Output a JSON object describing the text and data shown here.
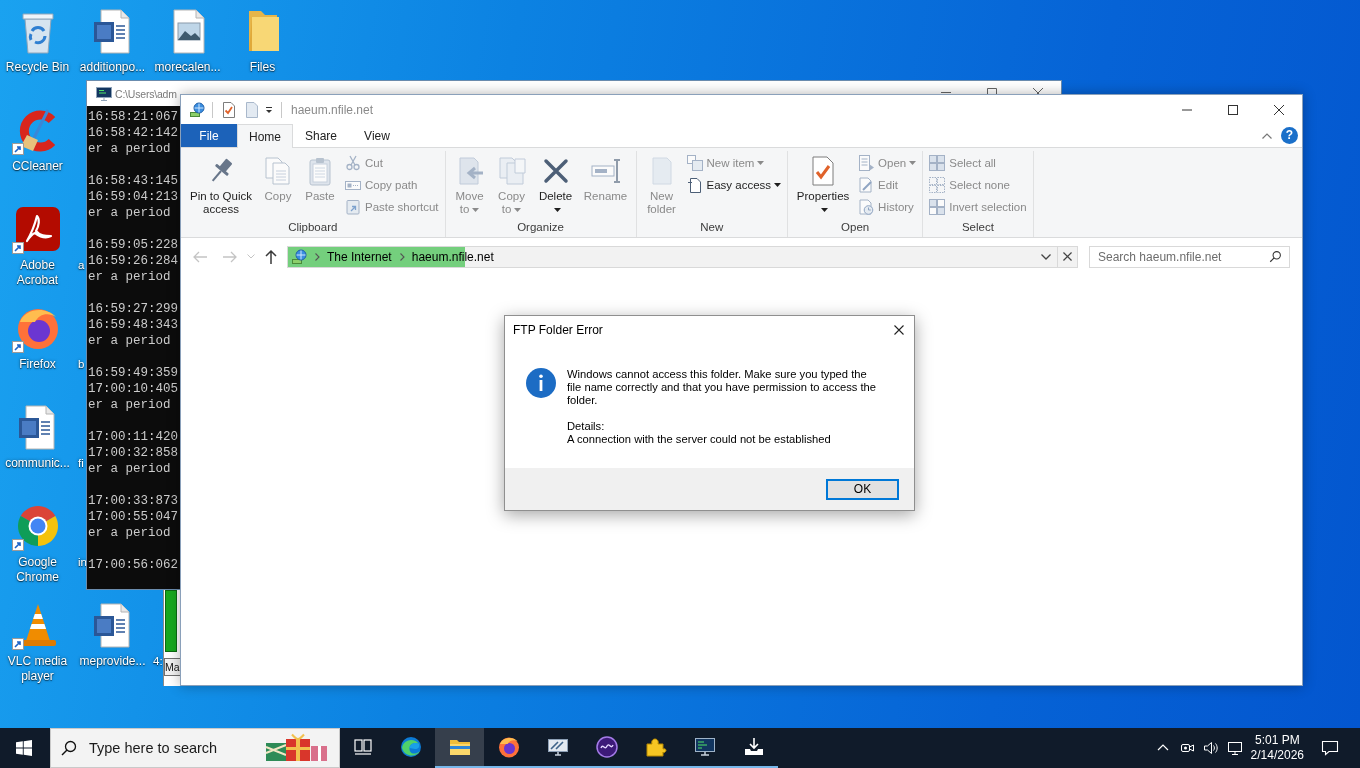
{
  "desktop": {
    "icons": [
      {
        "label": "Recycle Bin",
        "kind": "recycle-bin",
        "shortcut": false
      },
      {
        "label": "CCleaner",
        "kind": "ccleaner",
        "shortcut": true
      },
      {
        "label": "Adobe Acrobat",
        "kind": "acrobat",
        "shortcut": true
      },
      {
        "label": "Firefox",
        "kind": "firefox",
        "shortcut": true
      },
      {
        "label": "communic...",
        "kind": "word-document",
        "shortcut": false
      },
      {
        "label": "Google Chrome",
        "kind": "chrome",
        "shortcut": true
      },
      {
        "label": "VLC media player",
        "kind": "vlc",
        "shortcut": true
      },
      {
        "label": "additionpo...",
        "kind": "word-document",
        "shortcut": false
      },
      {
        "label": "a",
        "kind": "covered"
      },
      {
        "label": "b",
        "kind": "covered"
      },
      {
        "label": "fi",
        "kind": "covered"
      },
      {
        "label": "in",
        "kind": "covered"
      },
      {
        "label": "meprovide...",
        "kind": "word-document",
        "shortcut": false
      },
      {
        "label": "morecalen...",
        "kind": "image-file",
        "shortcut": false
      },
      {
        "label": "4:",
        "kind": "covered"
      },
      {
        "label": "Files",
        "kind": "folder",
        "shortcut": false
      }
    ]
  },
  "background_window": {
    "button": "Ma"
  },
  "console_window": {
    "title": "C:\\Users\\adm",
    "output": [
      [
        "16:58:21:067",
        "16:58:42:142",
        "er a period"
      ],
      [
        "16:58:43:145",
        "16:59:04:213",
        "er a period"
      ],
      [
        "16:59:05:228",
        "16:59:26:284",
        "er a period"
      ],
      [
        "16:59:27:299",
        "16:59:48:343",
        "er a period"
      ],
      [
        "16:59:49:359",
        "17:00:10:405",
        "er a period"
      ],
      [
        "17:00:11:420",
        "17:00:32:858",
        "er a period"
      ],
      [
        "17:00:33:873",
        "17:00:55:047",
        "er a period"
      ],
      [
        "17:00:56:062"
      ]
    ]
  },
  "explorer": {
    "title": "haeum.nfile.net",
    "tabs": [
      {
        "label": "File",
        "kind": "menu",
        "selected": false
      },
      {
        "label": "Home",
        "kind": "tab",
        "selected": true
      },
      {
        "label": "Share",
        "kind": "tab",
        "selected": false
      },
      {
        "label": "View",
        "kind": "tab",
        "selected": false
      }
    ],
    "help": "?",
    "ribbon": {
      "groups": [
        {
          "label": "Clipboard",
          "commands": [
            {
              "label": "Pin to Quick access",
              "kind": "large",
              "disabled": false,
              "dropdown": false
            },
            {
              "label": "Copy",
              "kind": "large",
              "disabled": true,
              "dropdown": false
            },
            {
              "label": "Paste",
              "kind": "large",
              "disabled": true,
              "dropdown": false
            },
            {
              "label": "Cut",
              "kind": "small",
              "disabled": true,
              "dropdown": false
            },
            {
              "label": "Copy path",
              "kind": "small",
              "disabled": true,
              "dropdown": false
            },
            {
              "label": "Paste shortcut",
              "kind": "small",
              "disabled": true,
              "dropdown": false
            }
          ]
        },
        {
          "label": "Organize",
          "commands": [
            {
              "label": "Move to",
              "kind": "large",
              "disabled": true,
              "dropdown": true
            },
            {
              "label": "Copy to",
              "kind": "large",
              "disabled": true,
              "dropdown": true
            },
            {
              "label": "Delete",
              "kind": "large",
              "disabled": false,
              "dropdown": true
            },
            {
              "label": "Rename",
              "kind": "large",
              "disabled": true,
              "dropdown": false
            }
          ]
        },
        {
          "label": "New",
          "commands": [
            {
              "label": "New folder",
              "kind": "large",
              "disabled": true,
              "dropdown": false
            },
            {
              "label": "New item",
              "kind": "small",
              "disabled": true,
              "dropdown": true
            },
            {
              "label": "Easy access",
              "kind": "small",
              "disabled": false,
              "dropdown": true
            }
          ]
        },
        {
          "label": "Open",
          "commands": [
            {
              "label": "Properties",
              "kind": "large",
              "disabled": false,
              "dropdown": true
            },
            {
              "label": "Open",
              "kind": "small",
              "disabled": true,
              "dropdown": true
            },
            {
              "label": "Edit",
              "kind": "small",
              "disabled": true,
              "dropdown": false
            },
            {
              "label": "History",
              "kind": "small",
              "disabled": true,
              "dropdown": false
            }
          ]
        },
        {
          "label": "Select",
          "commands": [
            {
              "label": "Select all",
              "kind": "small",
              "disabled": true,
              "dropdown": false
            },
            {
              "label": "Select none",
              "kind": "small",
              "disabled": true,
              "dropdown": false
            },
            {
              "label": "Invert selection",
              "kind": "small",
              "disabled": true,
              "dropdown": false
            }
          ]
        }
      ]
    },
    "nav": [
      {
        "kind": "back",
        "disabled": true
      },
      {
        "kind": "forward",
        "disabled": true
      },
      {
        "kind": "recent",
        "disabled": true
      },
      {
        "kind": "up",
        "disabled": false
      }
    ],
    "address_bar": {
      "crumbs": [
        "The Internet",
        "haeum.nfile.net"
      ],
      "level": 0.23
    },
    "search": {
      "placeholder": "Search haeum.nfile.net"
    }
  },
  "dialog": {
    "title": "FTP Folder Error",
    "message": "Windows cannot access this folder. Make sure you typed the file name correctly and that you have permission to access the folder.",
    "details_label": "Details:",
    "details": "A connection with the server could not be established",
    "buttons": [
      {
        "label": "OK",
        "default": true
      }
    ]
  },
  "taskbar": {
    "search": {
      "placeholder": "Type here to search"
    },
    "apps": [
      {
        "kind": "task-view",
        "running": false,
        "active": false
      },
      {
        "kind": "edge",
        "running": false,
        "active": false
      },
      {
        "kind": "file-explorer",
        "running": true,
        "active": true
      },
      {
        "kind": "firefox",
        "running": true,
        "active": false
      },
      {
        "kind": "monitor-app",
        "running": true,
        "active": false
      },
      {
        "kind": "orb-app",
        "running": true,
        "active": false
      },
      {
        "kind": "puzzle-app",
        "running": true,
        "active": false
      },
      {
        "kind": "terminal",
        "running": true,
        "active": false
      },
      {
        "kind": "downloader",
        "running": true,
        "active": false
      }
    ],
    "tray": {
      "time": "5:01 PM",
      "date": "2/14/2026"
    }
  }
}
